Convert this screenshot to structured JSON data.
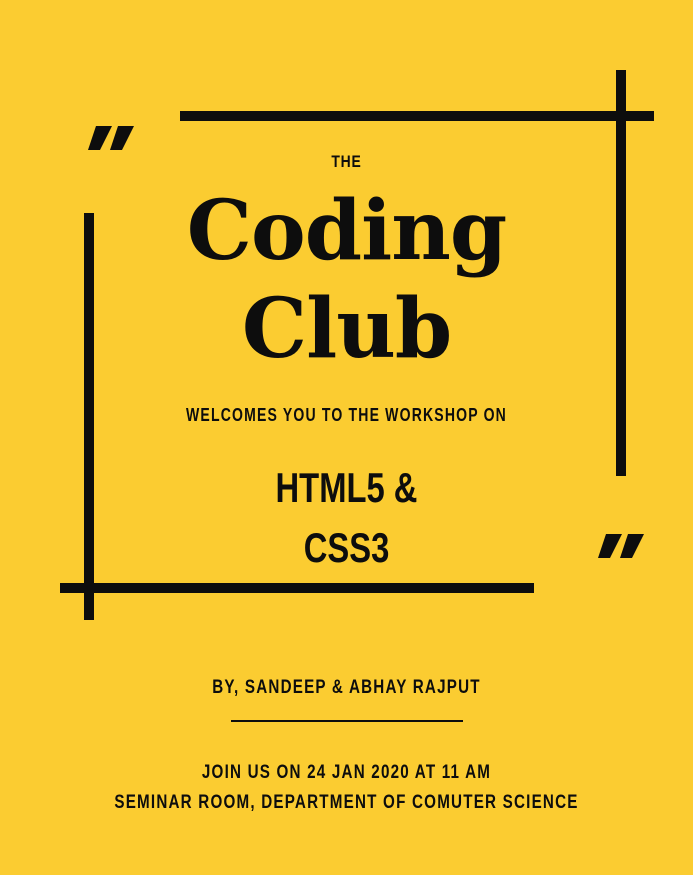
{
  "poster": {
    "the": "THE",
    "title_line1": "Coding",
    "title_line2": "Club",
    "subtitle": "WELCOMES YOU TO THE WORKSHOP ON",
    "topic_line1": "HTML5 &",
    "topic_line2": "CSS3",
    "byline": "BY, SANDEEP & ABHAY RAJPUT",
    "event_date": "JOIN US  ON 24 JAN 2020 AT 11 AM",
    "event_venue": "SEMINAR ROOM, DEPARTMENT OF COMUTER SCIENCE"
  },
  "colors": {
    "background": "#FBCC31",
    "ink": "#0d0d0d"
  },
  "icons": {
    "open_quote": "quote-mark-icon",
    "close_quote": "quote-mark-icon"
  }
}
